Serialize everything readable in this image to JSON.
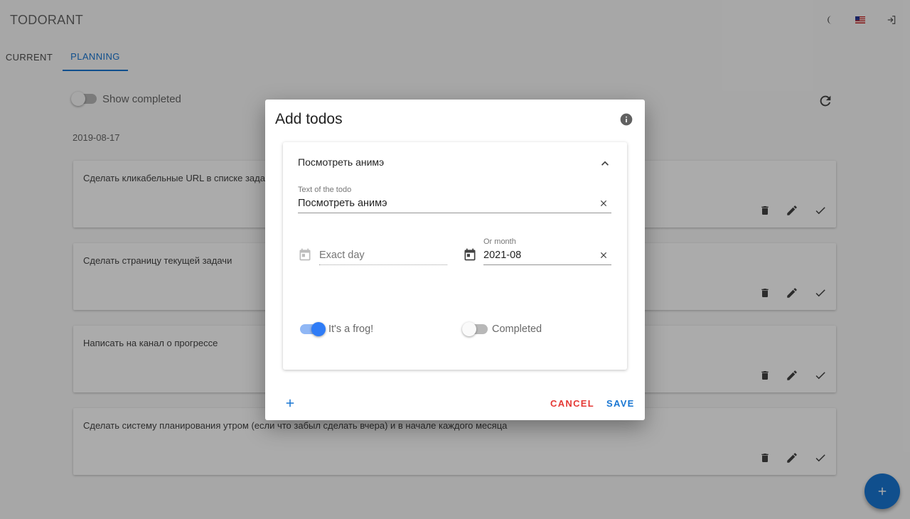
{
  "app": {
    "title": "TODORANT",
    "icons": [
      "moon-icon",
      "us-flag-icon",
      "logout-icon"
    ]
  },
  "tabs": [
    {
      "label": "CURRENT",
      "active": false
    },
    {
      "label": "PLANNING",
      "active": true
    }
  ],
  "controls": {
    "show_completed_label": "Show completed",
    "show_completed": false,
    "refresh_icon": "refresh-icon"
  },
  "date_header": "2019-08-17",
  "todos": [
    {
      "text": "Сделать кликабельные URL в списке задач"
    },
    {
      "text": "Сделать страницу текущей задачи"
    },
    {
      "text": "Написать на канал о прогрессе"
    },
    {
      "text": "Сделать систему планирования утром (если что забыл сделать вчера) и в начале каждого месяца"
    }
  ],
  "todo_action_icons": [
    "delete-icon",
    "edit-icon",
    "check-icon"
  ],
  "dialog": {
    "title": "Add todos",
    "info_icon": "info-icon",
    "panel": {
      "header": "Посмотреть анимэ",
      "text_label": "Text of the todo",
      "text_value": "Посмотреть анимэ",
      "exact_day_placeholder": "Exact day",
      "or_month_label": "Or month",
      "month_value": "2021-08",
      "frog_label": "It's a frog!",
      "frog": true,
      "completed_label": "Completed",
      "completed": false
    },
    "cancel_label": "CANCEL",
    "save_label": "SAVE"
  },
  "colors": {
    "primary": "#1976d2",
    "cancel": "#e53935",
    "switch_on": "#2f7cf6"
  }
}
